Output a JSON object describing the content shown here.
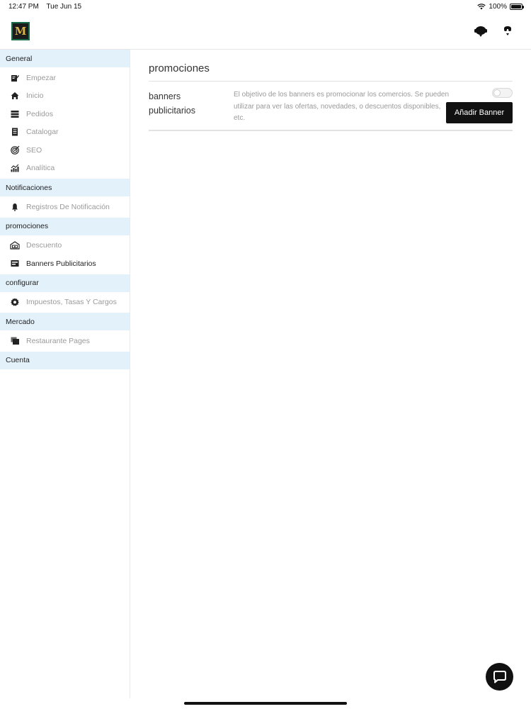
{
  "status_bar": {
    "time": "12:47 PM",
    "date": "Tue Jun 15",
    "battery": "100%"
  },
  "header": {
    "logo_text": "M",
    "icons": [
      "support-agent-icon",
      "user-account-icon"
    ]
  },
  "sidebar": {
    "sections": [
      {
        "title": "General",
        "items": [
          {
            "label": "Empezar",
            "icon": "edit-note-icon",
            "active": false
          },
          {
            "label": "Inicio",
            "icon": "home-icon",
            "active": false
          },
          {
            "label": "Pedidos",
            "icon": "orders-icon",
            "active": false
          },
          {
            "label": "Catalogar",
            "icon": "catalog-icon",
            "active": false
          },
          {
            "label": "SEO",
            "icon": "target-icon",
            "active": false
          },
          {
            "label": "Analítica",
            "icon": "analytics-icon",
            "active": false
          }
        ]
      },
      {
        "title": "Notificaciones",
        "items": [
          {
            "label": "Registros De Notificación",
            "icon": "bell-icon",
            "active": false
          }
        ]
      },
      {
        "title": "promociones",
        "items": [
          {
            "label": "Descuento",
            "icon": "discount-icon",
            "active": false
          },
          {
            "label": "Banners Publicitarios",
            "icon": "banner-icon",
            "active": true
          }
        ]
      },
      {
        "title": "configurar",
        "items": [
          {
            "label": "Impuestos, Tasas Y Cargos",
            "icon": "gear-icon",
            "active": false
          }
        ]
      },
      {
        "title": "Mercado",
        "items": [
          {
            "label": "Restaurante Pages",
            "icon": "pages-icon",
            "active": false
          }
        ]
      },
      {
        "title": "Cuenta",
        "items": []
      }
    ]
  },
  "main": {
    "title": "promociones",
    "row": {
      "label": "banners publicitarios",
      "description": "El objetivo de los banners es promocionar los comercios. Se pueden utilizar para ver las ofertas, novedades, o descuentos disponibles, etc.",
      "toggle_on": false,
      "button_label": "Añadir Banner"
    }
  },
  "colors": {
    "section_bg": "#e3f1fb",
    "button_bg": "#111111",
    "muted_text": "#9a9a9a"
  }
}
